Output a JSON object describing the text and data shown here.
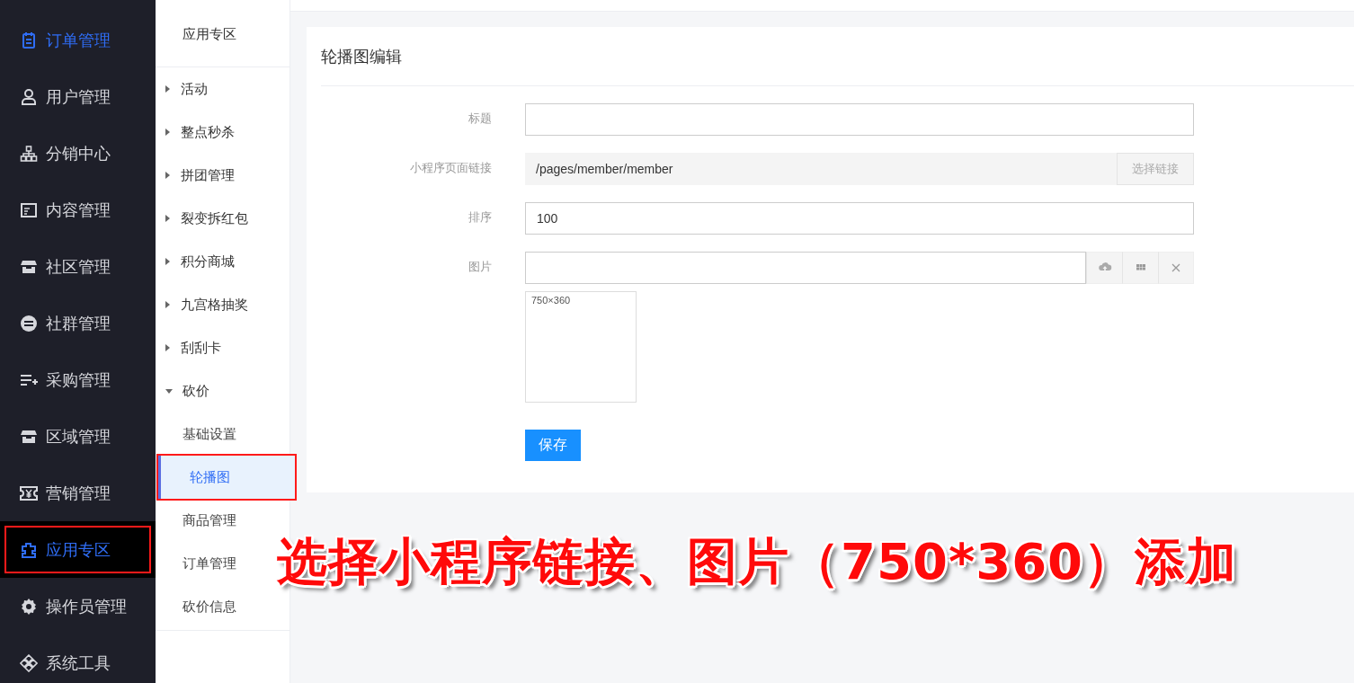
{
  "sidebar": {
    "items": [
      {
        "label": "订单管理",
        "active": true,
        "selected": false,
        "annotated": false
      },
      {
        "label": "用户管理",
        "active": false,
        "selected": false,
        "annotated": false
      },
      {
        "label": "分销中心",
        "active": false,
        "selected": false,
        "annotated": false
      },
      {
        "label": "内容管理",
        "active": false,
        "selected": false,
        "annotated": false
      },
      {
        "label": "社区管理",
        "active": false,
        "selected": false,
        "annotated": false
      },
      {
        "label": "社群管理",
        "active": false,
        "selected": false,
        "annotated": false
      },
      {
        "label": "采购管理",
        "active": false,
        "selected": false,
        "annotated": false
      },
      {
        "label": "区域管理",
        "active": false,
        "selected": false,
        "annotated": false
      },
      {
        "label": "营销管理",
        "active": false,
        "selected": false,
        "annotated": false
      },
      {
        "label": "应用专区",
        "active": true,
        "selected": true,
        "annotated": true
      },
      {
        "label": "操作员管理",
        "active": false,
        "selected": false,
        "annotated": false
      },
      {
        "label": "系统工具",
        "active": false,
        "selected": false,
        "annotated": false
      }
    ]
  },
  "subnav": {
    "title": "应用专区",
    "items": [
      {
        "label": "活动",
        "expanded": false
      },
      {
        "label": "整点秒杀",
        "expanded": false
      },
      {
        "label": "拼团管理",
        "expanded": false
      },
      {
        "label": "裂变拆红包",
        "expanded": false
      },
      {
        "label": "积分商城",
        "expanded": false
      },
      {
        "label": "九宫格抽奖",
        "expanded": false
      },
      {
        "label": "刮刮卡",
        "expanded": false
      },
      {
        "label": "砍价",
        "expanded": true,
        "children": [
          {
            "label": "基础设置",
            "selected": false,
            "annotated": false
          },
          {
            "label": "轮播图",
            "selected": true,
            "annotated": true
          },
          {
            "label": "商品管理",
            "selected": false,
            "annotated": false
          },
          {
            "label": "订单管理",
            "selected": false,
            "annotated": false
          },
          {
            "label": "砍价信息",
            "selected": false,
            "annotated": false
          }
        ]
      }
    ]
  },
  "form": {
    "title": "轮播图编辑",
    "fields": [
      {
        "kind": "text",
        "label": "标题"
      },
      {
        "kind": "link",
        "label": "小程序页面链接",
        "value": "/pages/member/member",
        "button": "选择链接"
      },
      {
        "kind": "text",
        "label": "排序",
        "value": "100"
      },
      {
        "kind": "image",
        "label": "图片",
        "preview_hint": "750×360"
      }
    ],
    "save_button": "保存"
  },
  "annotation": {
    "caption": "选择小程序链接、图片（750*360）添加"
  }
}
